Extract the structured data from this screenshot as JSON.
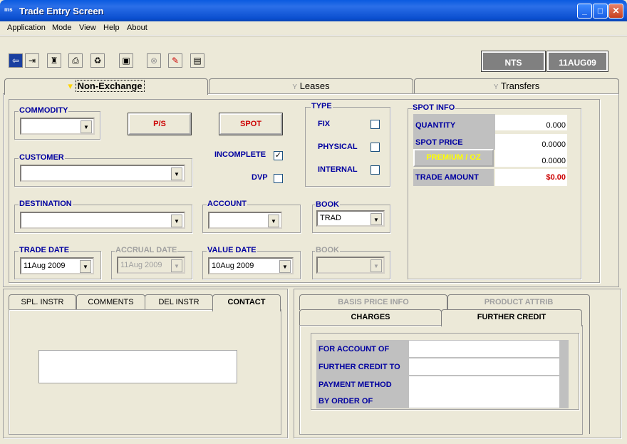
{
  "window": {
    "title": "Trade Entry Screen",
    "app_icon": "ms"
  },
  "menu": [
    "Application",
    "Mode",
    "View",
    "Help",
    "About"
  ],
  "toolbar_icons": [
    "exit-arrow-icon",
    "door-exit-icon",
    "person-icon",
    "print-icon",
    "recycle-icon",
    "save-disk-icon",
    "cancel-circle-icon",
    "edit-note-icon",
    "printer-desk-icon"
  ],
  "status": {
    "system": "NTS",
    "date": "11AUG09"
  },
  "main_tabs": [
    {
      "label": "Non-Exchange",
      "icon": "▾"
    },
    {
      "label": "Leases",
      "icon": "Y"
    },
    {
      "label": "Transfers",
      "icon": "Y"
    }
  ],
  "form": {
    "commodity_label": "COMMODITY",
    "commodity_value": "",
    "ps_button": "P/S",
    "spot_button": "SPOT",
    "customer_label": "CUSTOMER",
    "customer_value": "",
    "incomplete_label": "INCOMPLETE",
    "incomplete_checked": "✓",
    "dvp_label": "DVP",
    "dvp_checked": "",
    "type_label": "TYPE",
    "type_fix": "FIX",
    "type_physical": "PHYSICAL",
    "type_internal": "INTERNAL",
    "destination_label": "DESTINATION",
    "destination_value": "",
    "account_label": "ACCOUNT",
    "account_value": "",
    "book_label": "BOOK",
    "book_value": "TRAD",
    "trade_date_label": "TRADE DATE",
    "trade_date_value": "11Aug 2009",
    "accrual_date_label": "ACCRUAL DATE",
    "accrual_date_value": "11Aug 2009",
    "value_date_label": "VALUE DATE",
    "value_date_value": "10Aug 2009",
    "book2_label": "BOOK",
    "book2_value": ""
  },
  "spot_info": {
    "title": "SPOT INFO",
    "quantity_label": "QUANTITY",
    "quantity_value": "0.000",
    "spot_price_label": "SPOT PRICE",
    "spot_price_value": "0.0000",
    "premium_button": "PREMIUM / OZ",
    "premium_value": "0.0000",
    "trade_amount_label": "TRADE AMOUNT",
    "trade_amount_value": "$0.00"
  },
  "left_tabs": [
    "SPL. INSTR",
    "COMMENTS",
    "DEL INSTR",
    "CONTACT"
  ],
  "right_tabs_back": [
    "BASIS PRICE INFO",
    "PRODUCT ATTRIB"
  ],
  "right_tabs_front": [
    "CHARGES",
    "FURTHER CREDIT"
  ],
  "further_credit": {
    "rows": [
      "FOR ACCOUNT OF",
      "FURTHER CREDIT TO",
      "PAYMENT METHOD",
      "BY ORDER OF"
    ]
  },
  "colors": {
    "titlebar": "#0a5be0",
    "label_blue": "#0000a0",
    "button_red": "#cc0000",
    "premium_yellow": "#ffff00",
    "amount_red": "#cc0000"
  }
}
